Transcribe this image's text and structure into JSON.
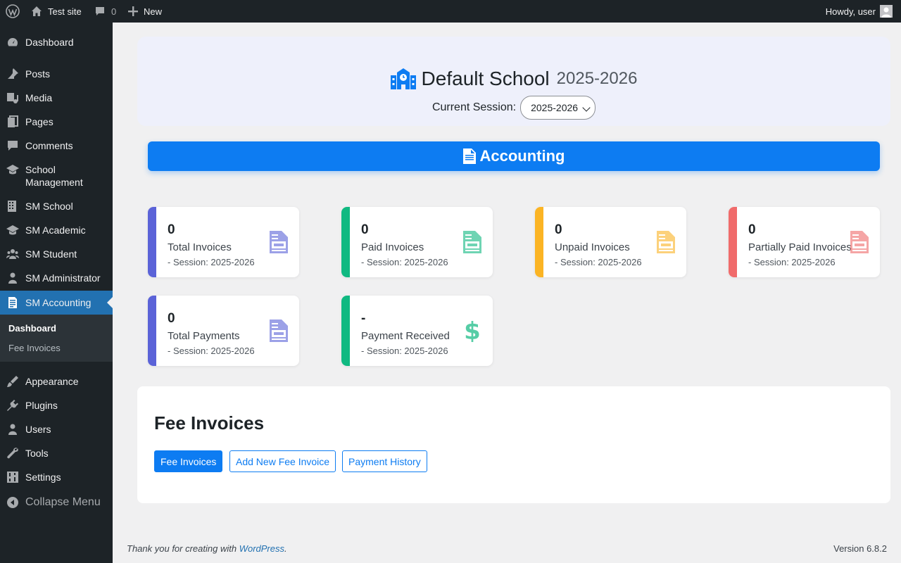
{
  "adminbar": {
    "site_name": "Test site",
    "comments_count": "0",
    "new_label": "New",
    "howdy": "Howdy, user"
  },
  "sidebar": {
    "items": [
      {
        "label": "Dashboard",
        "icon": "dashboard-icon"
      },
      {
        "label": "Posts",
        "icon": "pin-icon"
      },
      {
        "label": "Media",
        "icon": "media-icon"
      },
      {
        "label": "Pages",
        "icon": "pages-icon"
      },
      {
        "label": "Comments",
        "icon": "comment-icon"
      },
      {
        "label": "School Management",
        "icon": "graduation-cap-icon"
      },
      {
        "label": "SM School",
        "icon": "building-icon"
      },
      {
        "label": "SM Academic",
        "icon": "graduation-cap-icon"
      },
      {
        "label": "SM Student",
        "icon": "groups-icon"
      },
      {
        "label": "SM Administrator",
        "icon": "admin-icon"
      },
      {
        "label": "SM Accounting",
        "icon": "document-icon"
      },
      {
        "label": "Appearance",
        "icon": "brush-icon"
      },
      {
        "label": "Plugins",
        "icon": "plugin-icon"
      },
      {
        "label": "Users",
        "icon": "user-icon"
      },
      {
        "label": "Tools",
        "icon": "wrench-icon"
      },
      {
        "label": "Settings",
        "icon": "settings-icon"
      },
      {
        "label": "Collapse Menu",
        "icon": "collapse-icon"
      }
    ],
    "submenu": [
      "Dashboard",
      "Fee Invoices"
    ]
  },
  "header": {
    "school_name": "Default School",
    "school_year": "2025-2026",
    "session_label": "Current Session:",
    "session_value": "2025-2026"
  },
  "banner": {
    "title": "Accounting"
  },
  "cards": [
    {
      "value": "0",
      "label": "Total Invoices",
      "session": "- Session: 2025-2026",
      "color": "#5b63d8",
      "icon": "invoice-icon"
    },
    {
      "value": "0",
      "label": "Paid Invoices",
      "session": "- Session: 2025-2026",
      "color": "#10b981",
      "icon": "invoice-icon"
    },
    {
      "value": "0",
      "label": "Unpaid Invoices",
      "session": "- Session: 2025-2026",
      "color": "#fbb424",
      "icon": "invoice-icon"
    },
    {
      "value": "0",
      "label": "Partially Paid Invoices",
      "session": "- Session: 2025-2026",
      "color": "#f06b6b",
      "icon": "invoice-icon"
    },
    {
      "value": "0",
      "label": "Total Payments",
      "session": "- Session: 2025-2026",
      "color": "#5b63d8",
      "icon": "invoice-icon"
    },
    {
      "value": "-",
      "label": "Payment Received",
      "session": "- Session: 2025-2026",
      "color": "#10b981",
      "icon": "dollar-icon"
    }
  ],
  "fee_panel": {
    "title": "Fee Invoices",
    "buttons": [
      "Fee Invoices",
      "Add New Fee Invoice",
      "Payment History"
    ]
  },
  "footer": {
    "thanks_prefix": "Thank you for creating with",
    "wordpress_link": "WordPress",
    "thanks_suffix": ".",
    "version": "Version 6.8.2"
  }
}
